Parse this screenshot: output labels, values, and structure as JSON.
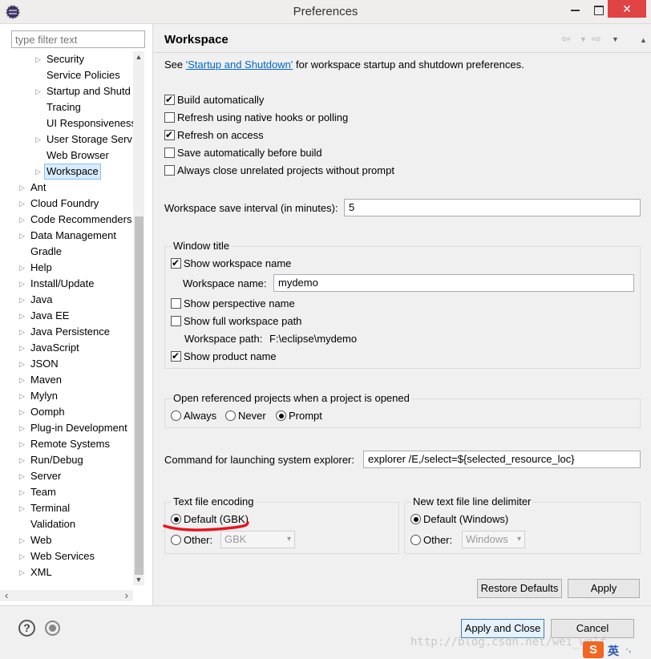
{
  "window": {
    "title": "Preferences",
    "close_glyph": "✕"
  },
  "filter": {
    "placeholder": "type filter text"
  },
  "tree": {
    "items": [
      {
        "label": "Security",
        "arrow": true
      },
      {
        "label": "Service Policies",
        "arrow": false
      },
      {
        "label": "Startup and Shutd",
        "arrow": true
      },
      {
        "label": "Tracing",
        "arrow": false
      },
      {
        "label": "UI Responsiveness",
        "arrow": false
      },
      {
        "label": "User Storage Serv",
        "arrow": true
      },
      {
        "label": "Web Browser",
        "arrow": false
      },
      {
        "label": "Workspace",
        "arrow": true,
        "selected": true
      },
      {
        "label": "Ant",
        "arrow": true
      },
      {
        "label": "Cloud Foundry",
        "arrow": true
      },
      {
        "label": "Code Recommenders",
        "arrow": true
      },
      {
        "label": "Data Management",
        "arrow": true
      },
      {
        "label": "Gradle",
        "arrow": false
      },
      {
        "label": "Help",
        "arrow": true
      },
      {
        "label": "Install/Update",
        "arrow": true
      },
      {
        "label": "Java",
        "arrow": true
      },
      {
        "label": "Java EE",
        "arrow": true
      },
      {
        "label": "Java Persistence",
        "arrow": true
      },
      {
        "label": "JavaScript",
        "arrow": true
      },
      {
        "label": "JSON",
        "arrow": true
      },
      {
        "label": "Maven",
        "arrow": true
      },
      {
        "label": "Mylyn",
        "arrow": true
      },
      {
        "label": "Oomph",
        "arrow": true
      },
      {
        "label": "Plug-in Development",
        "arrow": true
      },
      {
        "label": "Remote Systems",
        "arrow": true
      },
      {
        "label": "Run/Debug",
        "arrow": true
      },
      {
        "label": "Server",
        "arrow": true
      },
      {
        "label": "Team",
        "arrow": true
      },
      {
        "label": "Terminal",
        "arrow": true
      },
      {
        "label": "Validation",
        "arrow": false
      },
      {
        "label": "Web",
        "arrow": true
      },
      {
        "label": "Web Services",
        "arrow": true
      },
      {
        "label": "XML",
        "arrow": true
      }
    ]
  },
  "page": {
    "title": "Workspace",
    "see_prefix": "See ",
    "see_link": "'Startup and Shutdown'",
    "see_suffix": " for workspace startup and shutdown preferences.",
    "options": {
      "build_automatically": {
        "label": "Build automatically",
        "checked": true
      },
      "refresh_native": {
        "label": "Refresh using native hooks or polling",
        "checked": false
      },
      "refresh_on_access": {
        "label": "Refresh on access",
        "checked": true
      },
      "save_before_build": {
        "label": "Save automatically before build",
        "checked": false
      },
      "close_unrelated": {
        "label": "Always close unrelated projects without prompt",
        "checked": false
      }
    },
    "save_interval": {
      "label": "Workspace save interval (in minutes):",
      "value": "5"
    },
    "window_title": {
      "group_label": "Window title",
      "show_workspace_name": "Show workspace name",
      "workspace_name_label": "Workspace name:",
      "workspace_name_value": "mydemo",
      "show_perspective_name": "Show perspective name",
      "show_full_path": "Show full workspace path",
      "workspace_path_label": "Workspace path:",
      "workspace_path_value": "F:\\eclipse\\mydemo",
      "show_product_name": "Show product name"
    },
    "open_referenced": {
      "group_label": "Open referenced projects when a project is opened",
      "always": "Always",
      "never": "Never",
      "prompt": "Prompt",
      "selected": "prompt"
    },
    "explorer": {
      "label": "Command for launching system explorer:",
      "value": "explorer /E,/select=${selected_resource_loc}"
    },
    "encoding": {
      "group_label": "Text file encoding",
      "default_label": "Default (GBK)",
      "other_label": "Other:",
      "other_value": "GBK"
    },
    "line_delimiter": {
      "group_label": "New text file line delimiter",
      "default_label": "Default (Windows)",
      "other_label": "Other:",
      "other_value": "Windows"
    },
    "restore_defaults": "Restore Defaults",
    "apply": "Apply"
  },
  "footer": {
    "help_glyph": "?",
    "apply_and_close": "Apply and Close",
    "cancel": "Cancel",
    "watermark": "http://blog.csdn.net/wei_wolf",
    "ime_logo": "S",
    "ime_lang": "英",
    "ime_extra": "·,"
  },
  "colors": {
    "accent_link": "#0066cc",
    "selection_bg": "#d9ecfd",
    "annotation_red": "#e8141e",
    "close_red": "#e04343"
  }
}
